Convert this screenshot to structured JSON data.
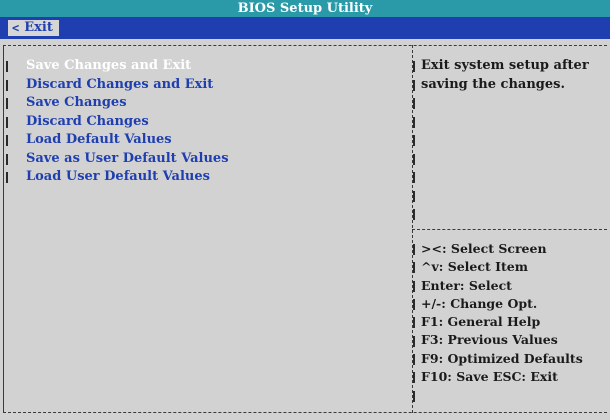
{
  "title": "BIOS Setup Utility",
  "menu_tab": {
    "label": "Exit",
    "icon": "chevron-left-icon"
  },
  "menu_items": [
    {
      "label": "Save Changes and Exit",
      "selected": true
    },
    {
      "label": "Discard Changes and Exit",
      "selected": false
    },
    {
      "label": "Save Changes",
      "selected": false
    },
    {
      "label": "Discard Changes",
      "selected": false
    },
    {
      "label": "Load Default Values",
      "selected": false
    },
    {
      "label": "Save as User Default Values",
      "selected": false
    },
    {
      "label": "Load User Default Values",
      "selected": false
    }
  ],
  "help": {
    "lines": [
      "Exit system setup after",
      "saving the changes."
    ]
  },
  "key_help": [
    "><: Select Screen",
    "^v: Select Item",
    "Enter: Select",
    "+/-: Change Opt.",
    "F1: General Help",
    "F3: Previous Values",
    "F9: Optimized Defaults",
    "F10: Save  ESC: Exit"
  ],
  "colors": {
    "title_bar": "#2b9aa8",
    "menu_bar": "#1f3fb0",
    "background": "#d2d2d2",
    "item_text": "#1f3fb0",
    "selected_text": "#ffffff"
  }
}
